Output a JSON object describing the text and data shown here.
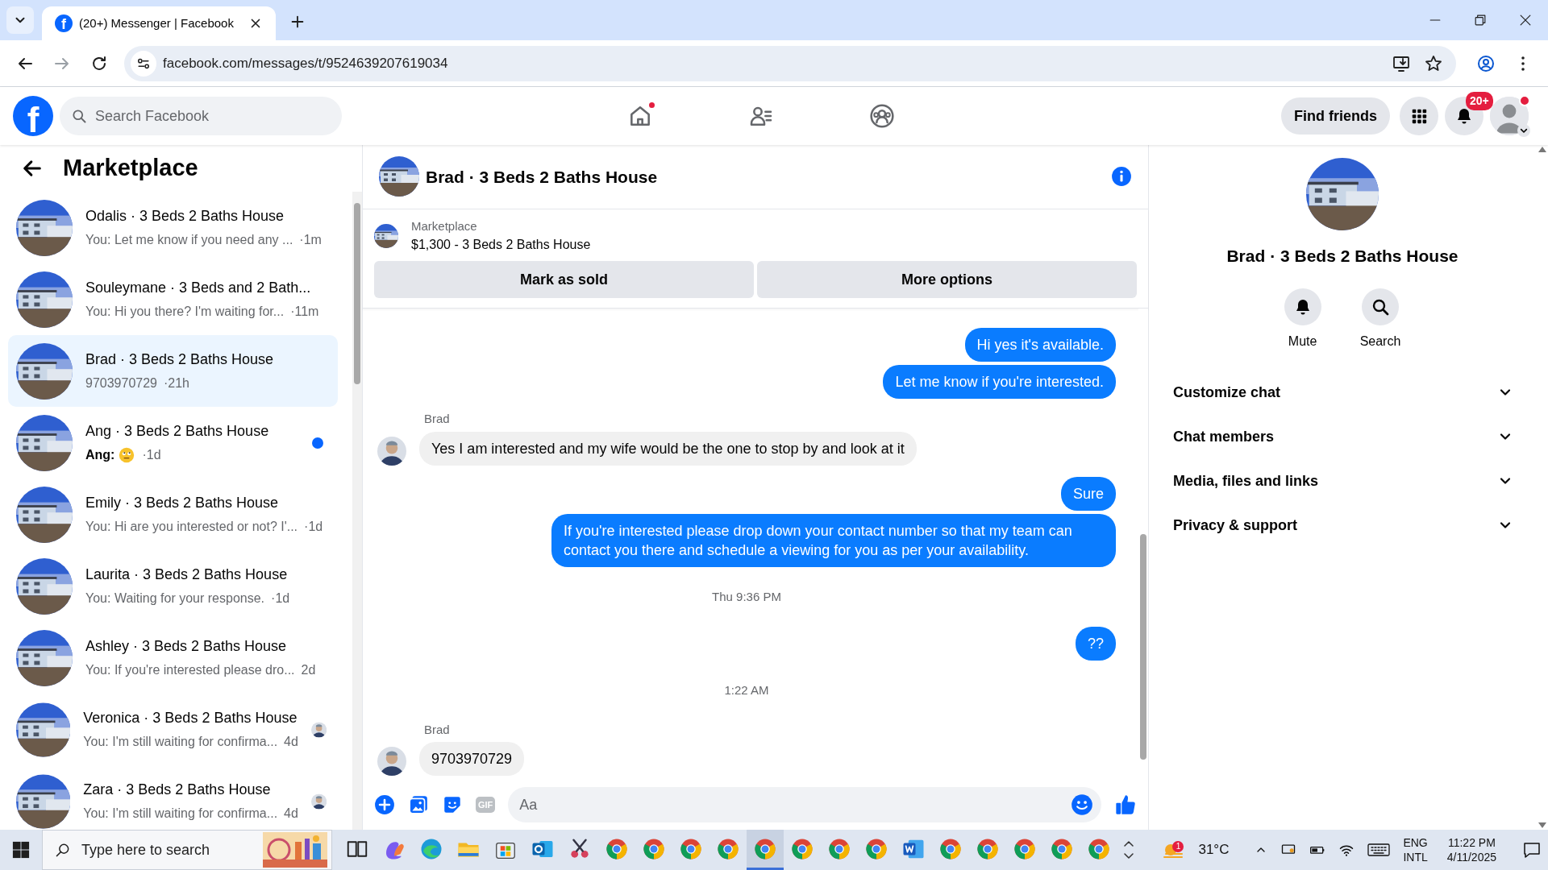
{
  "browser": {
    "favicon_letter": "f",
    "tab_title": "(20+) Messenger | Facebook",
    "url": "facebook.com/messages/t/9524639207619034"
  },
  "topbar": {
    "logo_letter": "f",
    "search_placeholder": "Search Facebook",
    "nav": [
      {
        "kind": "home",
        "dot": true
      },
      {
        "kind": "friends",
        "dot": false
      },
      {
        "kind": "groups",
        "dot": false
      }
    ],
    "find_friends": "Find friends",
    "notification_count": "20+"
  },
  "sidebar": {
    "title": "Marketplace",
    "conversations": [
      {
        "name": "Odalis · 3 Beds 2 Baths House",
        "preview": "You: Let me know if you need any ...",
        "time": "·1m",
        "selected": false,
        "unread": false,
        "seen": false
      },
      {
        "name": "Souleymane · 3 Beds and 2 Bath...",
        "preview": "You: Hi you there? I'm waiting for...",
        "time": "·11m",
        "selected": false,
        "unread": false,
        "seen": false
      },
      {
        "name": "Brad · 3 Beds 2 Baths House",
        "preview": "9703970729",
        "time": "·21h",
        "selected": true,
        "unread": false,
        "seen": false
      },
      {
        "name": "Ang · 3 Beds 2 Baths House",
        "preview": "Ang:",
        "time": "·1d",
        "selected": false,
        "unread": true,
        "seen": false
      },
      {
        "name": "Emily · 3 Beds 2 Baths House",
        "preview": "You: Hi are you interested or not? I'...",
        "time": "·1d",
        "selected": false,
        "unread": false,
        "seen": false
      },
      {
        "name": "Laurita · 3 Beds 2 Baths House",
        "preview": "You: Waiting for your response.",
        "time": "·1d",
        "selected": false,
        "unread": false,
        "seen": false
      },
      {
        "name": "Ashley · 3 Beds 2 Baths House",
        "preview": "You: If you're interested please dro...",
        "time": "2d",
        "selected": false,
        "unread": false,
        "seen": false
      },
      {
        "name": "Veronica · 3 Beds 2 Baths House",
        "preview": "You: I'm still waiting for confirma...",
        "time": "4d",
        "selected": false,
        "unread": false,
        "seen": true
      },
      {
        "name": "Zara · 3 Beds 2 Baths House",
        "preview": "You: I'm still waiting for confirma...",
        "time": "4d",
        "selected": false,
        "unread": false,
        "seen": true
      }
    ]
  },
  "chat": {
    "title": "Brad · 3 Beds 2 Baths House",
    "listing": {
      "source": "Marketplace",
      "title": "$1,300 - 3 Beds 2 Baths House",
      "actions": [
        "Mark as sold",
        "More options"
      ]
    },
    "messages": [
      {
        "kind": "out",
        "text": "Hi yes it's available."
      },
      {
        "kind": "out",
        "text": "Let me know if you're interested."
      },
      {
        "kind": "in",
        "sender": "Brad",
        "text": "Yes I am interested and my wife would be the one to stop by and look at it"
      },
      {
        "kind": "out",
        "text": "Sure"
      },
      {
        "kind": "out",
        "text": "If you're interested please drop down your contact number so that my team can contact you there and schedule a viewing for you as per your availability."
      },
      {
        "kind": "time",
        "text": "Thu 9:36 PM"
      },
      {
        "kind": "out",
        "text": "??"
      },
      {
        "kind": "time",
        "text": "1:22 AM"
      },
      {
        "kind": "in",
        "sender": "Brad",
        "text": "9703970729"
      }
    ],
    "composer": {
      "gif_label": "GIF",
      "placeholder": "Aa"
    }
  },
  "details": {
    "title": "Brad · 3 Beds 2 Baths House",
    "actions": [
      {
        "kind": "bell",
        "label": "Mute"
      },
      {
        "kind": "search",
        "label": "Search"
      }
    ],
    "sections": [
      {
        "label": "Customize chat",
        "expanded": false
      },
      {
        "label": "Chat members",
        "expanded": false
      },
      {
        "label": "Media, files and links",
        "expanded": false
      },
      {
        "label": "Privacy & support",
        "expanded": false
      }
    ]
  },
  "taskbar": {
    "search_placeholder": "Type here to search",
    "apps": [
      {
        "kind": "taskview",
        "selected": false
      },
      {
        "kind": "swirl",
        "selected": false
      },
      {
        "kind": "wave",
        "selected": false
      },
      {
        "kind": "folder",
        "selected": false
      },
      {
        "kind": "store",
        "selected": false
      },
      {
        "kind": "mail",
        "selected": false
      },
      {
        "kind": "snip",
        "selected": false
      },
      {
        "kind": "browser",
        "selected": false
      },
      {
        "kind": "browser",
        "selected": false
      },
      {
        "kind": "browser",
        "selected": false
      },
      {
        "kind": "browser",
        "selected": false
      },
      {
        "kind": "browser",
        "selected": true
      },
      {
        "kind": "browser",
        "selected": false
      },
      {
        "kind": "browser",
        "selected": false
      },
      {
        "kind": "browser",
        "selected": false
      },
      {
        "kind": "document",
        "selected": false
      },
      {
        "kind": "browser",
        "selected": false
      },
      {
        "kind": "browser",
        "selected": false
      },
      {
        "kind": "browser",
        "selected": false
      },
      {
        "kind": "browser",
        "selected": false
      },
      {
        "kind": "browser",
        "selected": false
      }
    ],
    "weather_badge": "1",
    "weather": "31°C",
    "language": "ENG",
    "layout": "INTL",
    "time": "11:22 PM",
    "date": "4/11/2025"
  }
}
